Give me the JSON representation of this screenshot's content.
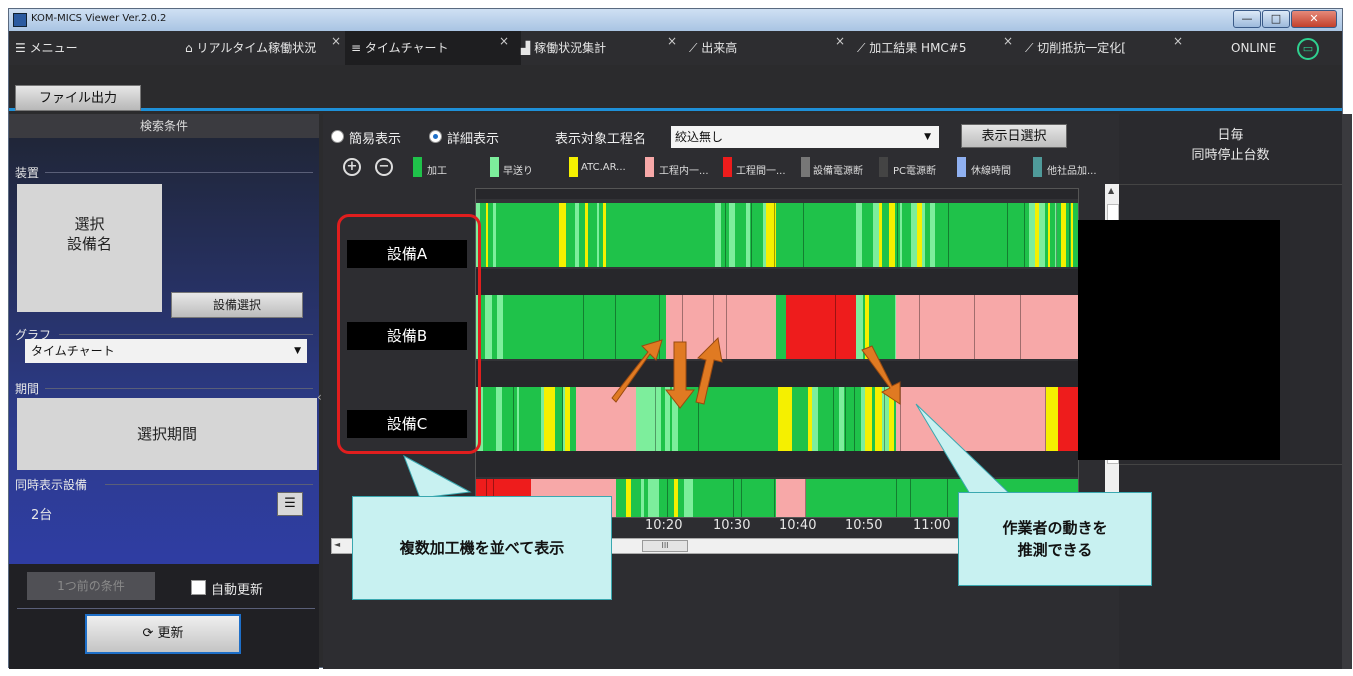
{
  "window": {
    "title": "KOM-MICS Viewer  Ver.2.0.2",
    "minimize": "—",
    "maximize": "□",
    "close": "✕"
  },
  "tabs": [
    {
      "label": "メニュー",
      "icon": "menu-icon"
    },
    {
      "label": "リアルタイム稼働状況",
      "icon": "factory-icon"
    },
    {
      "label": "タイムチャート",
      "icon": "timechart-icon",
      "active": true
    },
    {
      "label": "稼働状況集計",
      "icon": "bar-icon"
    },
    {
      "label": "出来高",
      "icon": "line-chart-icon"
    },
    {
      "label": "加工結果 HMC#5",
      "icon": "line-chart-icon"
    },
    {
      "label": "切削抵抗一定化[",
      "icon": "line-chart-icon"
    }
  ],
  "tab_close": "×",
  "status": {
    "online": "ONLINE"
  },
  "toolbar": {
    "file_output": "ファイル出力"
  },
  "left": {
    "header": "検索条件",
    "equipment_label": "装置",
    "selected_equipment": "選択\n設備名",
    "select_equipment_btn": "設備選択",
    "graph_label": "グラフ",
    "graph_value": "タイムチャート",
    "period_label": "期間",
    "selected_period": "選択期間",
    "simul_label": "同時表示設備",
    "simul_value": "2台",
    "prev_condition_btn": "1つ前の条件",
    "auto_update_label": "自動更新",
    "refresh_btn": "更新"
  },
  "main": {
    "simple_view": "簡易表示",
    "detail_view": "詳細表示",
    "process_label": "表示対象工程名",
    "process_value": "絞込無し",
    "date_select_btn": "表示日選択",
    "zoom_in": "+",
    "zoom_out": "−",
    "legend": [
      {
        "label": "加工",
        "color": "#1fc24a"
      },
      {
        "label": "早送り",
        "color": "#7dee9c"
      },
      {
        "label": "ATC.AR...",
        "color": "#f5f000"
      },
      {
        "label": "工程内一...",
        "color": "#f7a8a8"
      },
      {
        "label": "工程間一...",
        "color": "#ee1c1c"
      },
      {
        "label": "設備電源断",
        "color": "#777777"
      },
      {
        "label": "PC電源断",
        "color": "#444444"
      },
      {
        "label": "休線時間",
        "color": "#8fb0f0"
      },
      {
        "label": "他社品加...",
        "color": "#4f9a9a"
      }
    ],
    "equipment": [
      "設備A",
      "設備B",
      "設備C"
    ],
    "time_labels": [
      "10:20",
      "10:30",
      "10:40",
      "10:50",
      "11:00"
    ],
    "hscroll_thumb": "III",
    "collapse_arrow": "‹"
  },
  "right": {
    "title_line1": "日毎",
    "title_line2": "同時停止台数"
  },
  "callouts": {
    "left": "複数加工機を並べて表示",
    "right": "作業者の動きを\n推測できる"
  },
  "colors": {
    "accent": "#1e90d8",
    "callout_bg": "#c8f1f1",
    "highlight": "#e01e1e",
    "arrow": "#e07a22"
  }
}
